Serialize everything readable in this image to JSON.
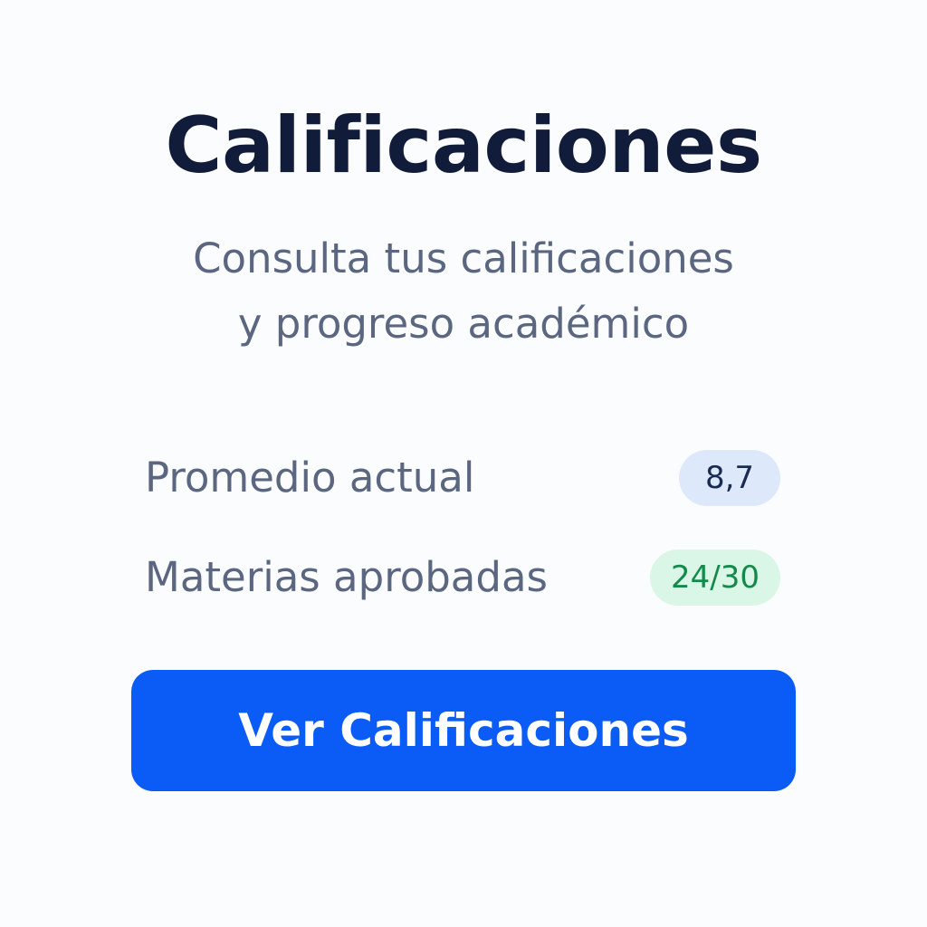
{
  "header": {
    "title": "Calificaciones",
    "subtitle_line1": "Consulta tus calificaciones",
    "subtitle_line2": "y progreso académico"
  },
  "stats": [
    {
      "label": "Promedio actual",
      "value": "8,7",
      "badge_color": "#dde9fb",
      "text_color": "#1a2b52"
    },
    {
      "label": "Materias aprobadas",
      "value": "24/30",
      "badge_color": "#daf6e6",
      "text_color": "#138a4a"
    }
  ],
  "action": {
    "button_label": "Ver Calificaciones",
    "accent_color": "#0b5cf7"
  }
}
